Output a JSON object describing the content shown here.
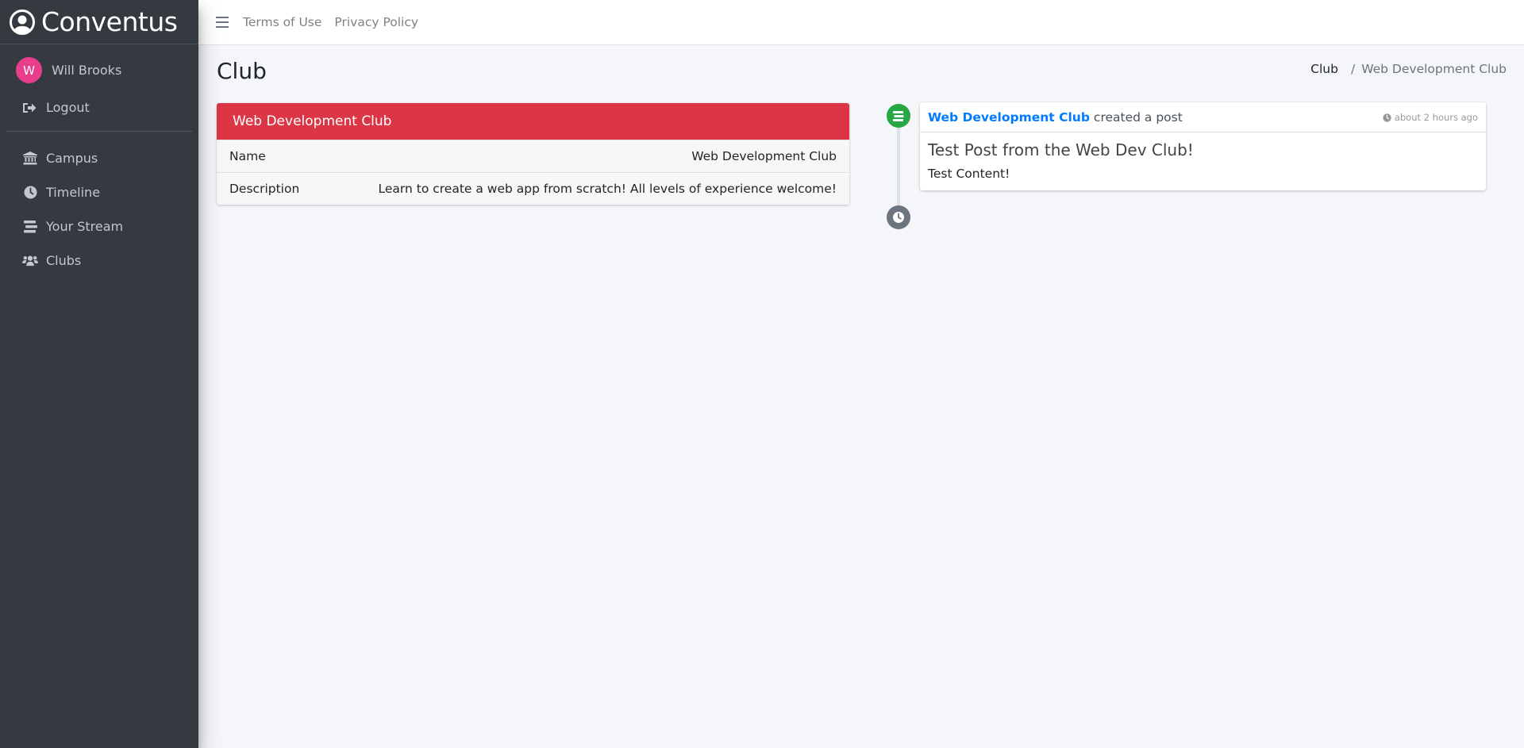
{
  "brand": {
    "name": "Conventus"
  },
  "user": {
    "initial": "W",
    "name": "Will Brooks"
  },
  "sidebar": {
    "logout_label": "Logout",
    "items": [
      {
        "label": "Campus",
        "icon": "university-icon"
      },
      {
        "label": "Timeline",
        "icon": "clock-icon"
      },
      {
        "label": "Your Stream",
        "icon": "stream-icon"
      },
      {
        "label": "Clubs",
        "icon": "users-icon"
      }
    ]
  },
  "topbar": {
    "links": [
      "Terms of Use",
      "Privacy Policy"
    ]
  },
  "page": {
    "title": "Club",
    "breadcrumb": {
      "parent": "Club",
      "separator": "/",
      "current": "Web Development Club"
    }
  },
  "club_card": {
    "header": "Web Development Club",
    "header_color": "#dc3545",
    "rows": [
      {
        "label": "Name",
        "value": "Web Development Club"
      },
      {
        "label": "Description",
        "value": "Learn to create a web app from scratch! All levels of experience welcome!"
      }
    ]
  },
  "timeline": {
    "item": {
      "actor": "Web Development Club",
      "action": "created a post",
      "time": "about 2 hours ago",
      "post_title": "Test Post from the Web Dev Club!",
      "post_content": "Test Content!"
    }
  },
  "colors": {
    "sidebar_bg": "#343a40",
    "accent_link": "#007bff",
    "avatar": "#e83e8c",
    "timeline_green": "#28a745",
    "timeline_gray": "#6c757d"
  }
}
